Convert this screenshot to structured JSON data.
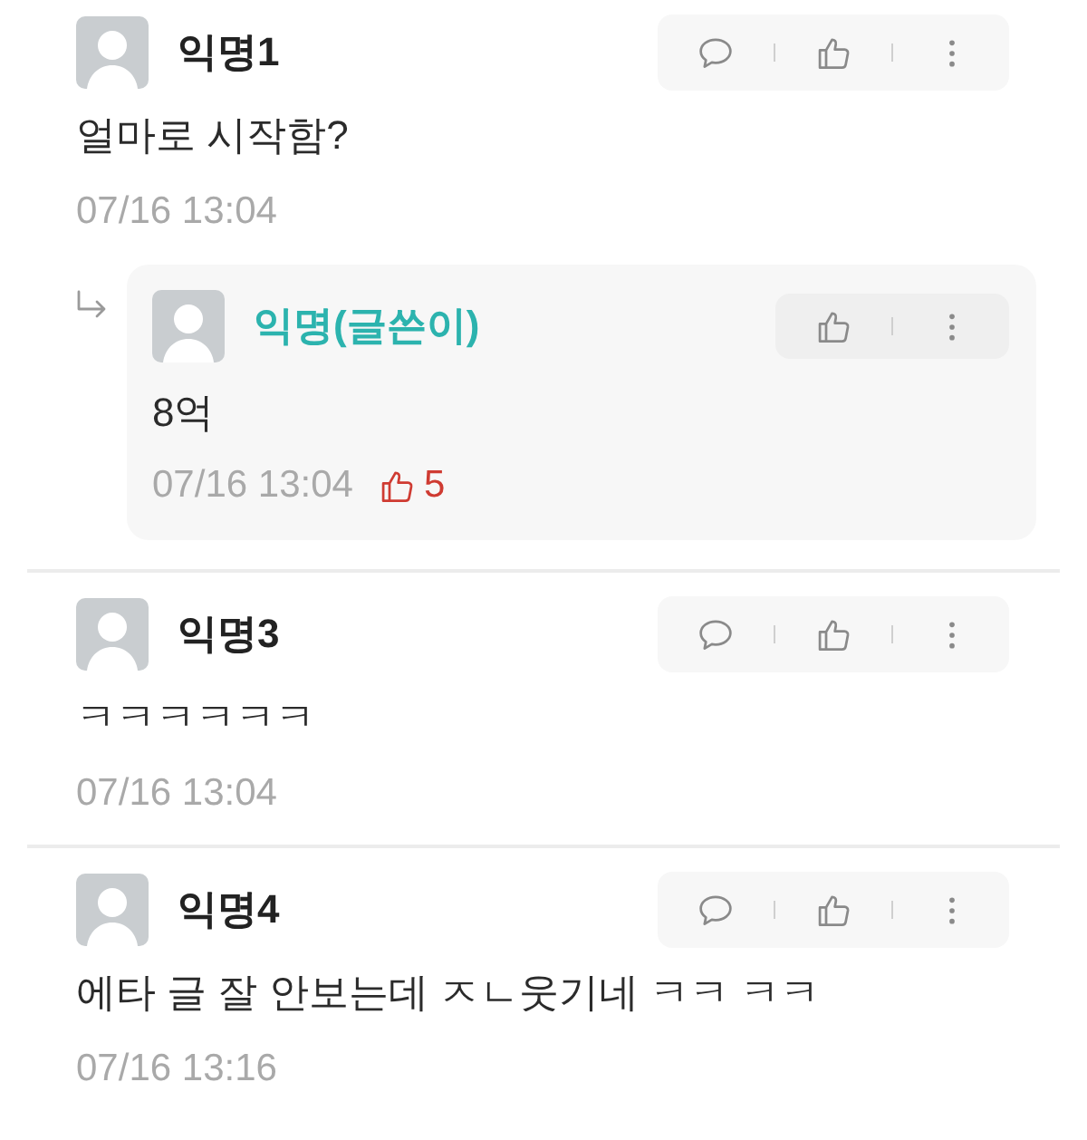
{
  "comments": [
    {
      "author": "익명1",
      "is_writer": false,
      "body": "얼마로 시작함?",
      "time": "07/16 13:04",
      "actions": [
        {
          "kind": "comment"
        },
        {
          "kind": "like"
        },
        {
          "kind": "more"
        }
      ],
      "replies": [
        {
          "author": "익명(글쓴이)",
          "is_writer": true,
          "body": "8억",
          "time": "07/16 13:04",
          "likes": "5",
          "actions": [
            {
              "kind": "like"
            },
            {
              "kind": "more"
            }
          ]
        }
      ]
    },
    {
      "author": "익명3",
      "is_writer": false,
      "body": "ㅋㅋㅋㅋㅋㅋ",
      "time": "07/16 13:04",
      "actions": [
        {
          "kind": "comment"
        },
        {
          "kind": "like"
        },
        {
          "kind": "more"
        }
      ]
    },
    {
      "author": "익명4",
      "is_writer": false,
      "body": "에타 글 잘 안보는데 ㅈㄴ웃기네 ㅋㅋ ㅋㅋ",
      "time": "07/16 13:16",
      "actions": [
        {
          "kind": "comment"
        },
        {
          "kind": "like"
        },
        {
          "kind": "more"
        }
      ]
    }
  ]
}
